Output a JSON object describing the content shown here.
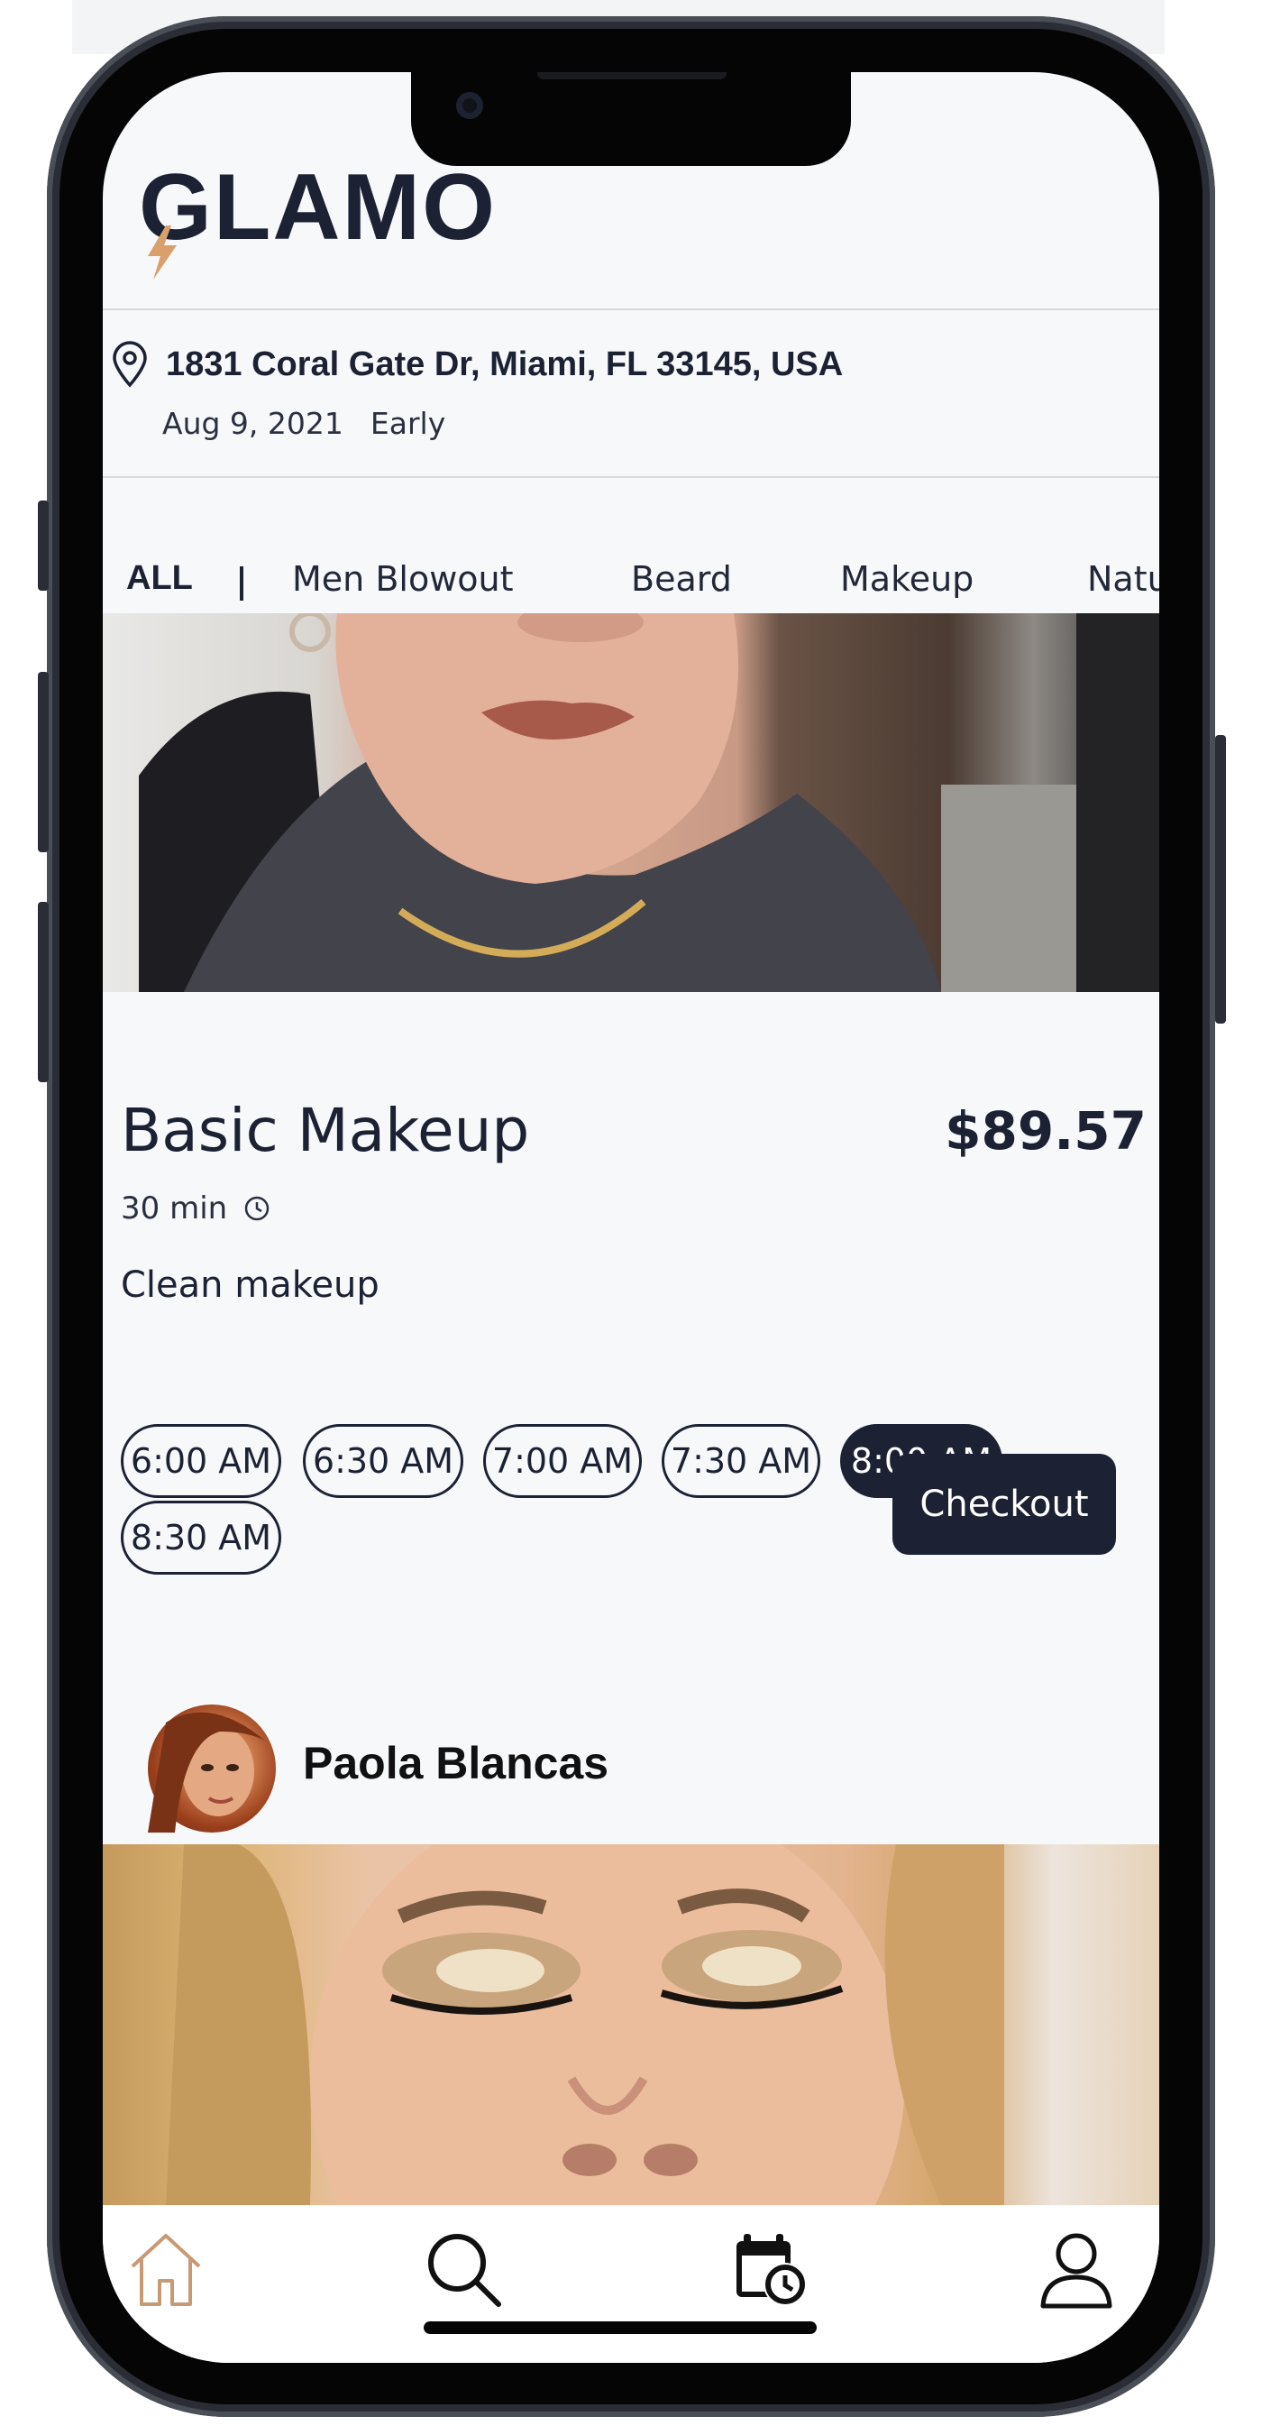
{
  "brand": {
    "logo_text": "GLAMO",
    "accent": "#d9a06b",
    "primary": "#1c2233"
  },
  "location": {
    "address": "1831 Coral Gate Dr, Miami, FL 33145, USA",
    "date": "Aug 9, 2021",
    "time_of_day": "Early"
  },
  "categories": [
    {
      "label": "ALL",
      "active": true
    },
    {
      "label": "Men Blowout"
    },
    {
      "label": "Beard"
    },
    {
      "label": "Makeup"
    },
    {
      "label": "Natu"
    }
  ],
  "service": {
    "title": "Basic Makeup",
    "price": "$89.57",
    "duration": "30 min",
    "description": "Clean makeup",
    "slots": [
      {
        "label": "6:00 AM"
      },
      {
        "label": "6:30 AM"
      },
      {
        "label": "7:00 AM"
      },
      {
        "label": "7:30 AM"
      },
      {
        "label": "8:00 AM",
        "selected": true
      },
      {
        "label": "8:30 AM"
      }
    ],
    "checkout_label": "Checkout"
  },
  "stylist": {
    "name": "Paola Blancas"
  },
  "tabbar": {
    "items": [
      {
        "icon": "home-icon",
        "active": true
      },
      {
        "icon": "search-icon"
      },
      {
        "icon": "calendar-clock-icon"
      },
      {
        "icon": "profile-icon"
      }
    ]
  }
}
